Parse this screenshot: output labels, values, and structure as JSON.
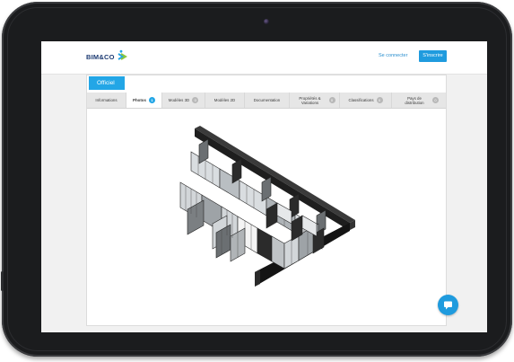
{
  "header": {
    "logo_text": "BIM&CO",
    "login_label": "Se connecter",
    "signup_label": "S'inscrire"
  },
  "product": {
    "status_tab": "Officiel",
    "tabs": [
      {
        "label": "Informations",
        "badge": ""
      },
      {
        "label": "Photos",
        "badge": "1"
      },
      {
        "label": "Modèles 3D",
        "badge": "0"
      },
      {
        "label": "Modèles 2D",
        "badge": "0"
      },
      {
        "label": "Documentation",
        "badge": ""
      },
      {
        "label": "Propriétés & Variations",
        "badge": "0"
      },
      {
        "label": "Classifications",
        "badge": "0"
      },
      {
        "label": "Pays de distribution",
        "badge": "0"
      }
    ],
    "active_tab": "Photos"
  },
  "colors": {
    "accent": "#1f9bde",
    "brand_dark": "#1d3b73",
    "bezel": "#1b1c1e"
  },
  "icons": {
    "chat": "chat-bubble-icon",
    "logo_mark": "bimandco-logo-icon"
  }
}
